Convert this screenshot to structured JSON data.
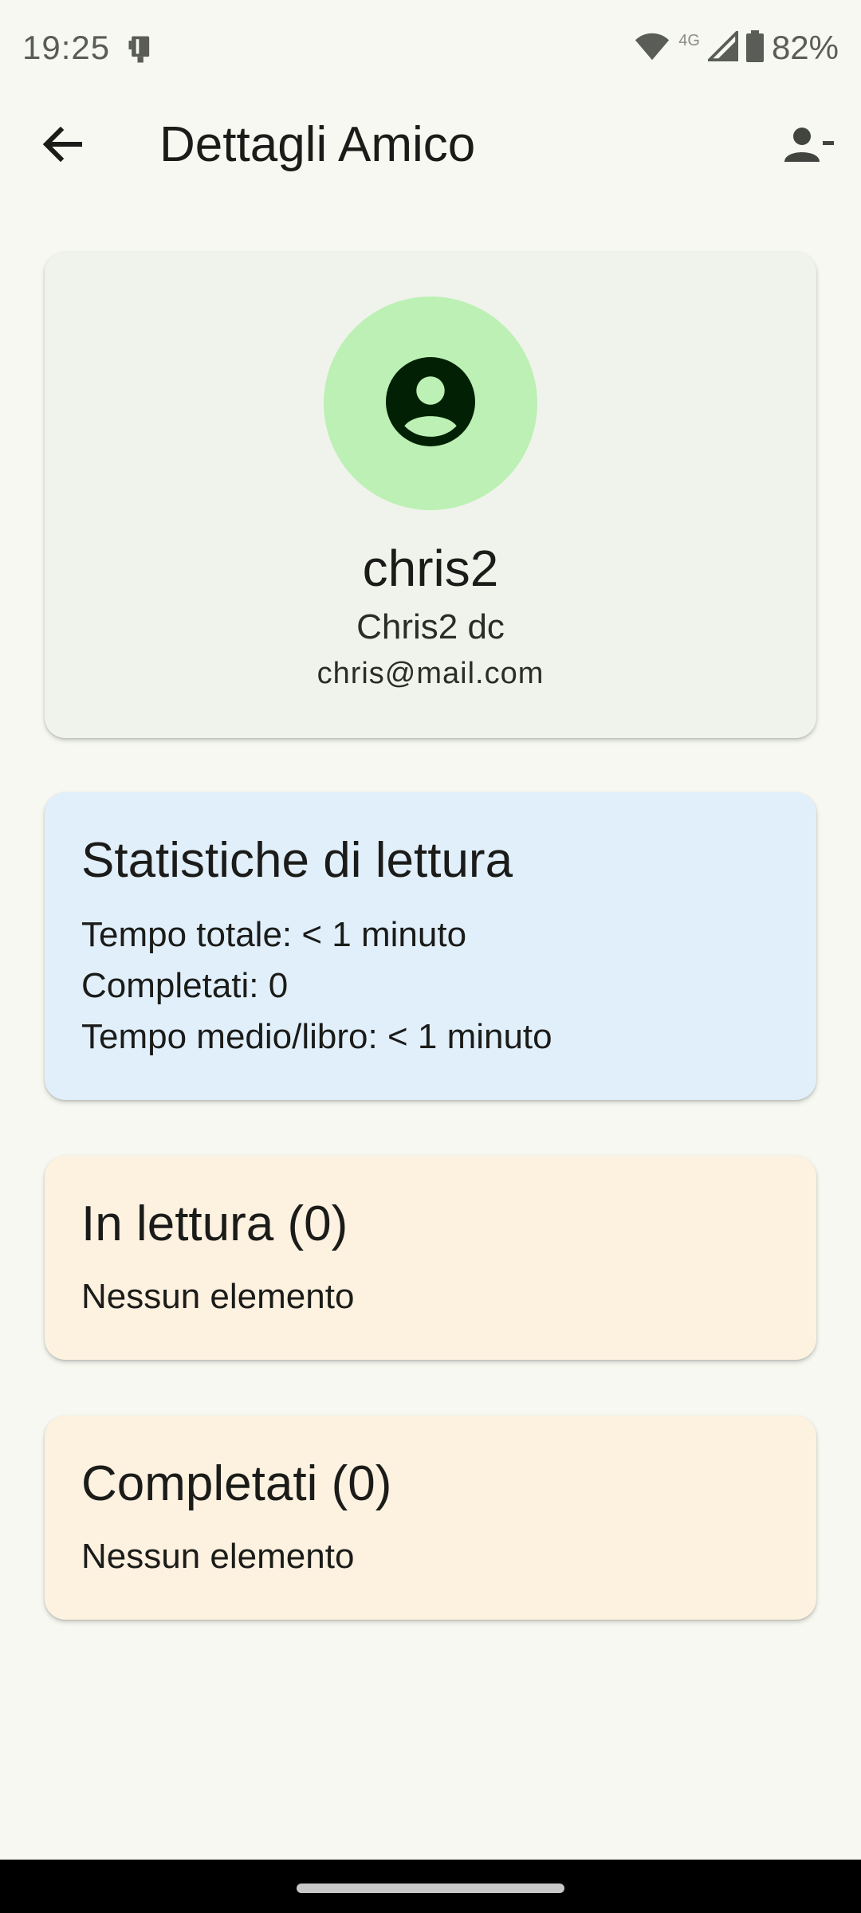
{
  "status_bar": {
    "time": "19:25",
    "network_label": "4G",
    "battery": "82%",
    "icons": [
      "notification-app-icon",
      "wifi-icon",
      "signal-icon",
      "battery-icon"
    ]
  },
  "app_bar": {
    "title": "Dettagli Amico",
    "icons": [
      "back-arrow-icon",
      "person-remove-icon"
    ]
  },
  "profile": {
    "username": "chris2",
    "full_name": "Chris2 dc",
    "email": "chris@mail.com",
    "avatar_icon": "account-circle-icon",
    "avatar_color": "#bcf0b4"
  },
  "stats": {
    "title": "Statistiche di lettura",
    "total_time": "Tempo totale: < 1 minuto",
    "completed": "Completati: 0",
    "avg_time": "Tempo medio/libro: < 1 minuto",
    "background": "#e1effb"
  },
  "reading": {
    "title": "In lettura (0)",
    "empty": "Nessun elemento",
    "background": "#fdf1e0"
  },
  "completed_section": {
    "title": "Completati (0)",
    "empty": "Nessun elemento"
  }
}
